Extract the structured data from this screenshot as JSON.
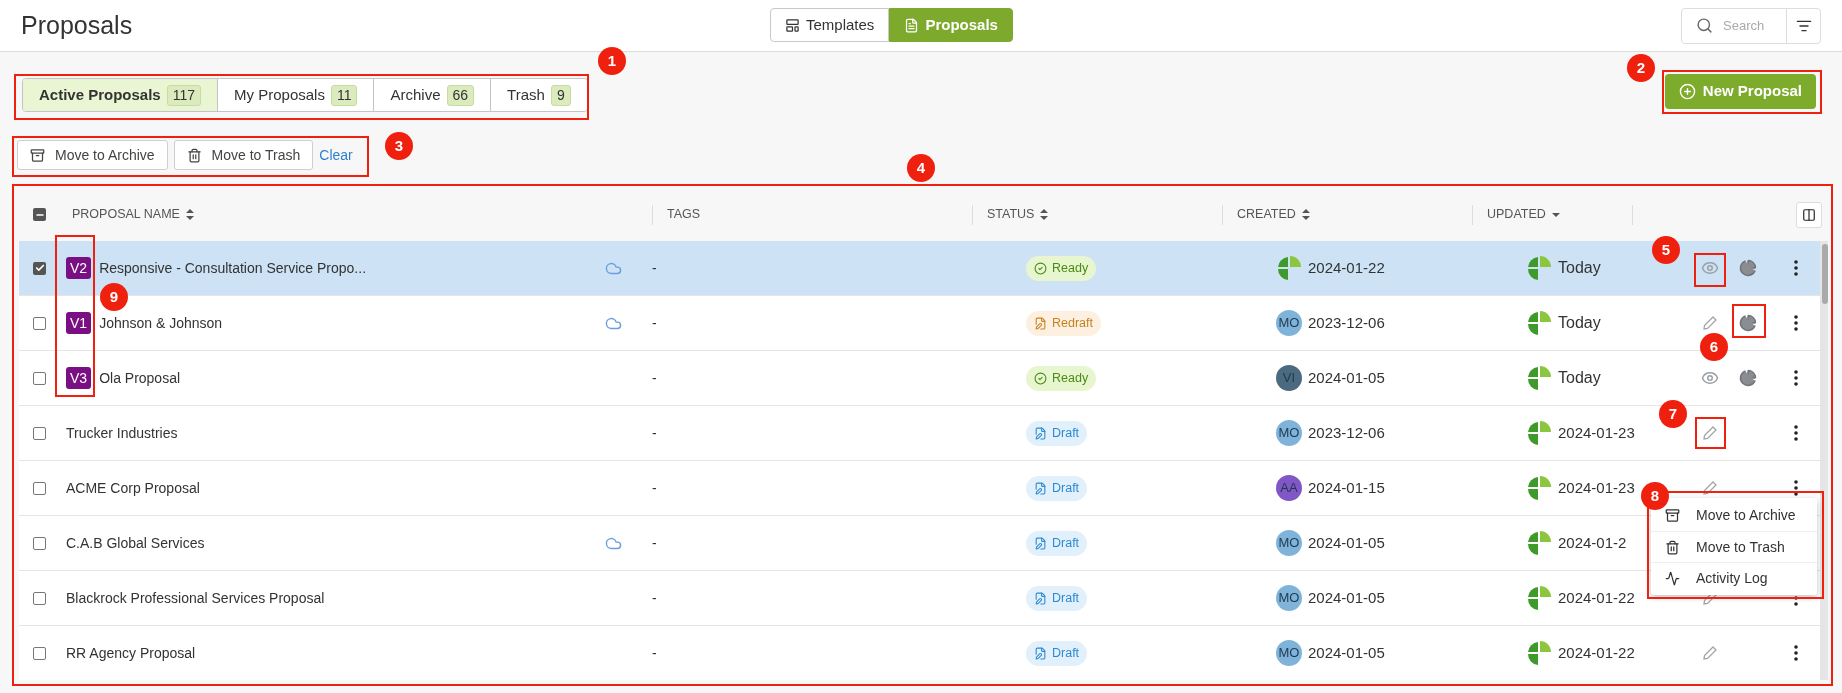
{
  "page_title": "Proposals",
  "view_switch": [
    {
      "label": "Templates",
      "kind": "templates",
      "selected": false
    },
    {
      "label": "Proposals",
      "kind": "proposals",
      "selected": true
    }
  ],
  "search": {
    "placeholder": "Search"
  },
  "tabs": [
    {
      "label": "Active Proposals",
      "count": "117",
      "selected": true
    },
    {
      "label": "My Proposals",
      "count": "11",
      "selected": false
    },
    {
      "label": "Archive",
      "count": "66",
      "selected": false
    },
    {
      "label": "Trash",
      "count": "9",
      "selected": false
    }
  ],
  "new_button": "New Proposal",
  "bulk_actions": [
    {
      "label": "Move to Archive",
      "kind": "archive"
    },
    {
      "label": "Move to Trash",
      "kind": "trash"
    }
  ],
  "clear_link": "Clear",
  "table": {
    "some_selected": true,
    "columns": [
      {
        "label": "PROPOSAL NAME",
        "kind": "sortable"
      },
      {
        "label": "TAGS",
        "kind": "plain"
      },
      {
        "label": "STATUS",
        "kind": "sortable"
      },
      {
        "label": "CREATED",
        "kind": "sortable"
      },
      {
        "label": "UPDATED",
        "kind": "sorted"
      }
    ],
    "rows": [
      {
        "selected": true,
        "version": "V2",
        "name": "Responsive - Consultation Service Propo...",
        "synced": true,
        "tags": "-",
        "status": {
          "label": "Ready",
          "kind": "ready"
        },
        "creator": {
          "kind": "logo"
        },
        "created": "2024-01-22",
        "updated": "Today",
        "actions": [
          {
            "kind": "view"
          },
          {
            "kind": "stats"
          },
          {
            "kind": "more"
          }
        ]
      },
      {
        "selected": false,
        "version": "V1",
        "name": "Johnson & Johnson",
        "synced": true,
        "tags": "-",
        "status": {
          "label": "Redraft",
          "kind": "redraft"
        },
        "creator": {
          "kind": "initials",
          "initials": "MO",
          "color": "#7fb3d9"
        },
        "created": "2023-12-06",
        "updated": "Today",
        "actions": [
          {
            "kind": "edit"
          },
          {
            "kind": "stats"
          },
          {
            "kind": "more"
          }
        ]
      },
      {
        "selected": false,
        "version": "V3",
        "name": "Ola Proposal",
        "synced": false,
        "tags": "-",
        "status": {
          "label": "Ready",
          "kind": "ready"
        },
        "creator": {
          "kind": "initials",
          "initials": "VI",
          "color": "#4b6a80"
        },
        "created": "2024-01-05",
        "updated": "Today",
        "actions": [
          {
            "kind": "view"
          },
          {
            "kind": "stats"
          },
          {
            "kind": "more"
          }
        ]
      },
      {
        "selected": false,
        "name": "Trucker Industries",
        "synced": false,
        "tags": "-",
        "status": {
          "label": "Draft",
          "kind": "draft"
        },
        "creator": {
          "kind": "initials",
          "initials": "MO",
          "color": "#7fb3d9"
        },
        "created": "2023-12-06",
        "updated": "2024-01-23",
        "actions": [
          {
            "kind": "edit"
          },
          {
            "kind": "more"
          }
        ]
      },
      {
        "selected": false,
        "name": "ACME Corp Proposal",
        "synced": false,
        "tags": "-",
        "status": {
          "label": "Draft",
          "kind": "draft"
        },
        "creator": {
          "kind": "initials",
          "initials": "AA",
          "color": "#8156c7"
        },
        "created": "2024-01-15",
        "updated": "2024-01-23",
        "actions": [
          {
            "kind": "edit"
          },
          {
            "kind": "more"
          }
        ]
      },
      {
        "selected": false,
        "name": "C.A.B Global Services",
        "synced": true,
        "tags": "-",
        "status": {
          "label": "Draft",
          "kind": "draft"
        },
        "creator": {
          "kind": "initials",
          "initials": "MO",
          "color": "#7fb3d9"
        },
        "created": "2024-01-05",
        "updated": "2024-01-2",
        "actions": []
      },
      {
        "selected": false,
        "name": "Blackrock Professional Services Proposal",
        "synced": false,
        "tags": "-",
        "status": {
          "label": "Draft",
          "kind": "draft"
        },
        "creator": {
          "kind": "initials",
          "initials": "MO",
          "color": "#7fb3d9"
        },
        "created": "2024-01-05",
        "updated": "2024-01-22",
        "actions": [
          {
            "kind": "edit"
          },
          {
            "kind": "more"
          }
        ]
      },
      {
        "selected": false,
        "name": "RR Agency Proposal",
        "synced": false,
        "tags": "-",
        "status": {
          "label": "Draft",
          "kind": "draft"
        },
        "creator": {
          "kind": "initials",
          "initials": "MO",
          "color": "#7fb3d9"
        },
        "created": "2024-01-05",
        "updated": "2024-01-22",
        "actions": [
          {
            "kind": "edit"
          },
          {
            "kind": "more"
          }
        ]
      }
    ]
  },
  "row_menu": [
    {
      "label": "Move to Archive",
      "kind": "archive"
    },
    {
      "label": "Move to Trash",
      "kind": "trash"
    },
    {
      "label": "Activity Log",
      "kind": "activity"
    }
  ],
  "callouts": [
    "1",
    "2",
    "3",
    "4",
    "5",
    "6",
    "7",
    "8",
    "9"
  ]
}
